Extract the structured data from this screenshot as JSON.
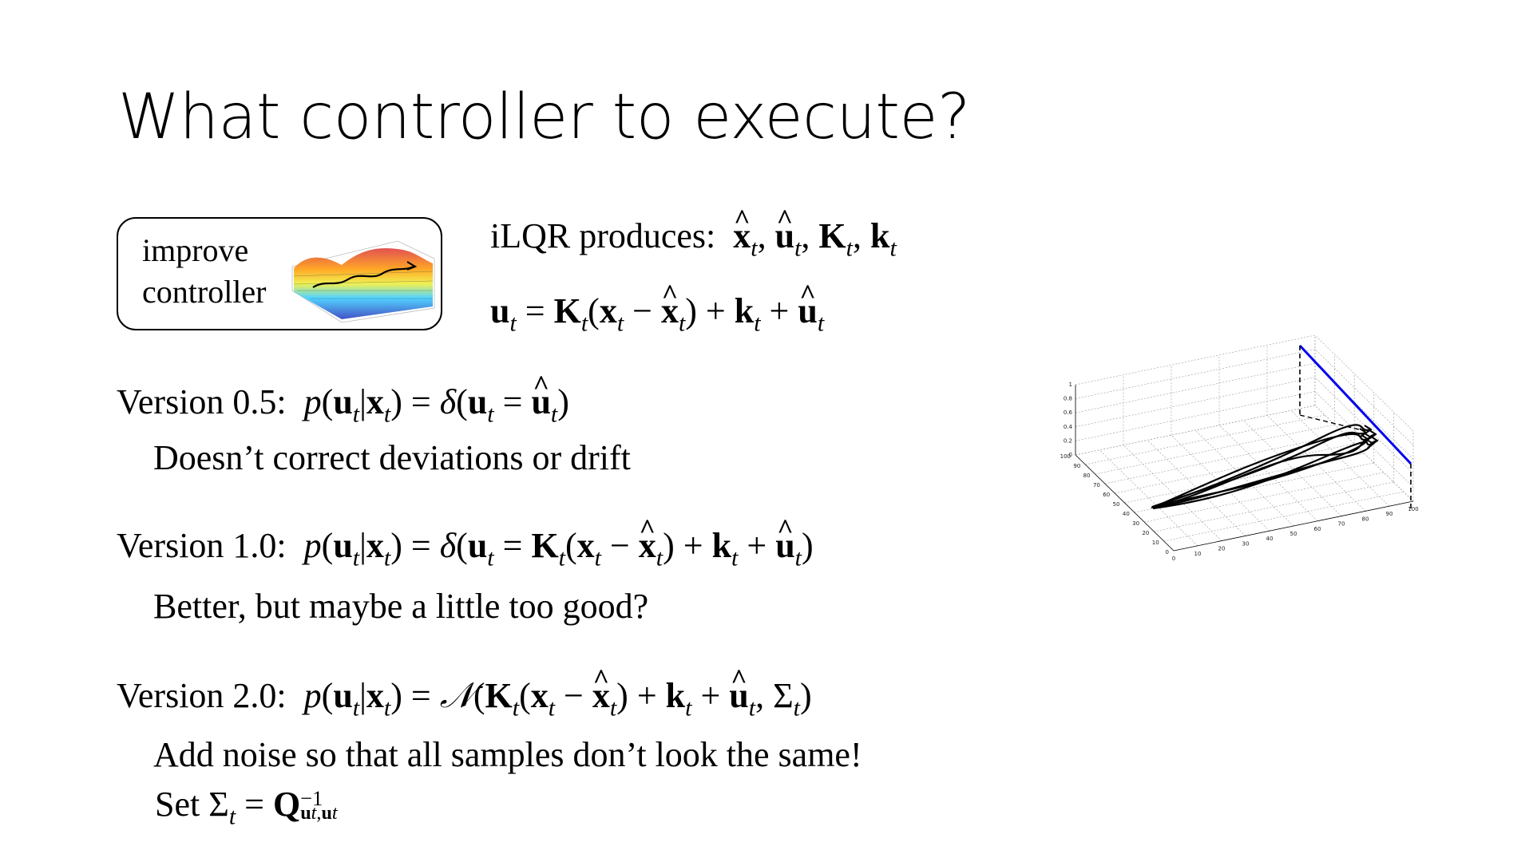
{
  "title": "What controller to execute?",
  "controller_box": {
    "line1": "improve",
    "line2": "controller"
  },
  "ilqr": {
    "prefix": "iLQR produces:"
  },
  "versions": [
    {
      "label": "Version 0.5:",
      "note": "Doesn’t correct deviations or drift"
    },
    {
      "label": "Version 1.0:",
      "note": "Better, but maybe a little too good?"
    },
    {
      "label": "Version 2.0:",
      "note": "Add noise so that all samples don’t look the same!"
    }
  ],
  "set_sigma": {
    "prefix": "Set"
  },
  "figure": {
    "z_ticks": [
      "1",
      "0.8",
      "0.6",
      "0.4",
      "0.2",
      "0"
    ],
    "y_ticks": [
      "100",
      "90",
      "80",
      "70",
      "60",
      "50",
      "40",
      "30",
      "20",
      "10",
      "0"
    ],
    "x_ticks": [
      "0",
      "10",
      "20",
      "30",
      "40",
      "50",
      "60",
      "70",
      "80",
      "90",
      "100"
    ],
    "colors": {
      "target_line": "#0000ee",
      "trajectories": "#000000",
      "grid": "#999999"
    }
  }
}
